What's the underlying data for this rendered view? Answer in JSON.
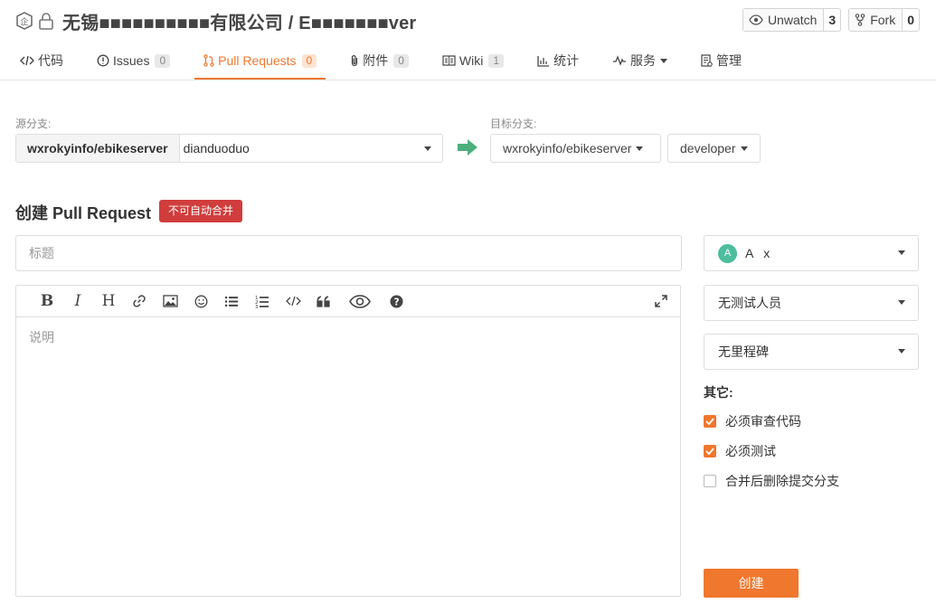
{
  "header": {
    "repo_title": "无锡■■■■■■■■■■有限公司 / E■■■■■■■ver",
    "unwatch_label": "Unwatch",
    "unwatch_count": "3",
    "fork_label": "Fork",
    "fork_count": "0"
  },
  "tabs": [
    {
      "label": "代码",
      "icon": "code-icon"
    },
    {
      "label": "Issues",
      "badge": "0",
      "icon": "issue-icon"
    },
    {
      "label": "Pull Requests",
      "badge": "0",
      "icon": "pull-request-icon",
      "active": true
    },
    {
      "label": "附件",
      "badge": "0",
      "icon": "paperclip-icon"
    },
    {
      "label": "Wiki",
      "badge": "1",
      "icon": "book-icon"
    },
    {
      "label": "统计",
      "icon": "bar-chart-icon"
    },
    {
      "label": "服务",
      "icon": "pulse-icon"
    },
    {
      "label": "管理",
      "icon": "settings-doc-icon"
    }
  ],
  "branch": {
    "source_label": "源分支:",
    "source_repo": "wxrokyinfo/ebikeserver",
    "source_branch": "dianduoduo",
    "target_label": "目标分支:",
    "target_repo": "wxrokyinfo/ebikeserver",
    "target_branch": "developer"
  },
  "form": {
    "title": "创建 Pull Request",
    "merge_warning": "不可自动合并",
    "title_placeholder": "标题",
    "description_placeholder": "说明",
    "create_label": "创建"
  },
  "sidebar": {
    "assignee_initial": "A",
    "assignee_name": "A   x",
    "tester": "无测试人员",
    "milestone": "无里程碑",
    "other_label": "其它:",
    "options": [
      {
        "label": "必须审查代码",
        "checked": true
      },
      {
        "label": "必须测试",
        "checked": true
      },
      {
        "label": "合并后删除提交分支",
        "checked": false
      }
    ]
  },
  "colors": {
    "accent": "#f0772e",
    "warning": "#d13d3d",
    "arrow": "#4caf7d"
  }
}
